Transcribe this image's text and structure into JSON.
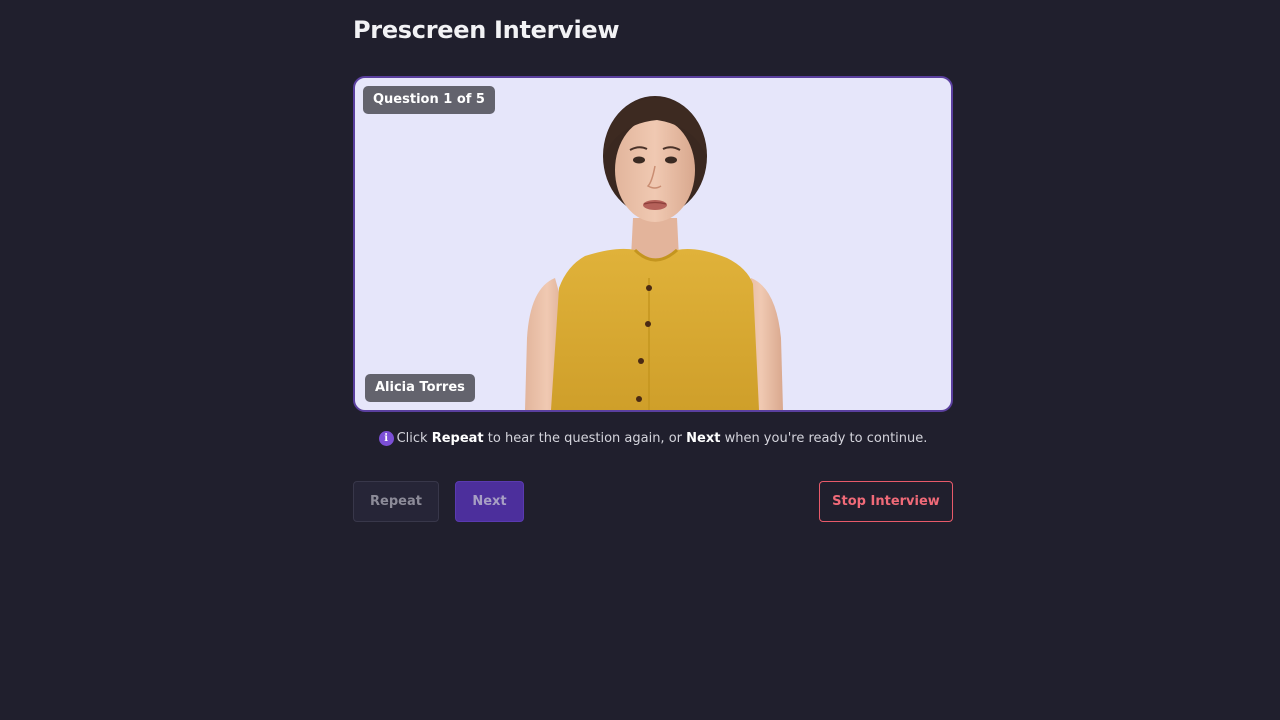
{
  "page": {
    "title": "Prescreen Interview"
  },
  "video": {
    "question_badge": "Question 1 of 5",
    "speaker_name": "Alicia Torres",
    "avatar_description_icon": "interviewer-avatar"
  },
  "info": {
    "icon": "info-icon",
    "prefix": "Click ",
    "repeat_word": "Repeat",
    "middle": " to hear the question again, or ",
    "next_word": "Next",
    "suffix": " when you're ready to continue."
  },
  "controls": {
    "repeat_label": "Repeat",
    "next_label": "Next",
    "stop_label": "Stop Interview"
  },
  "colors": {
    "background": "#201f2d",
    "accent": "#4c2f9c",
    "danger": "#e85a6a",
    "video_bg": "#e6e6fa"
  }
}
